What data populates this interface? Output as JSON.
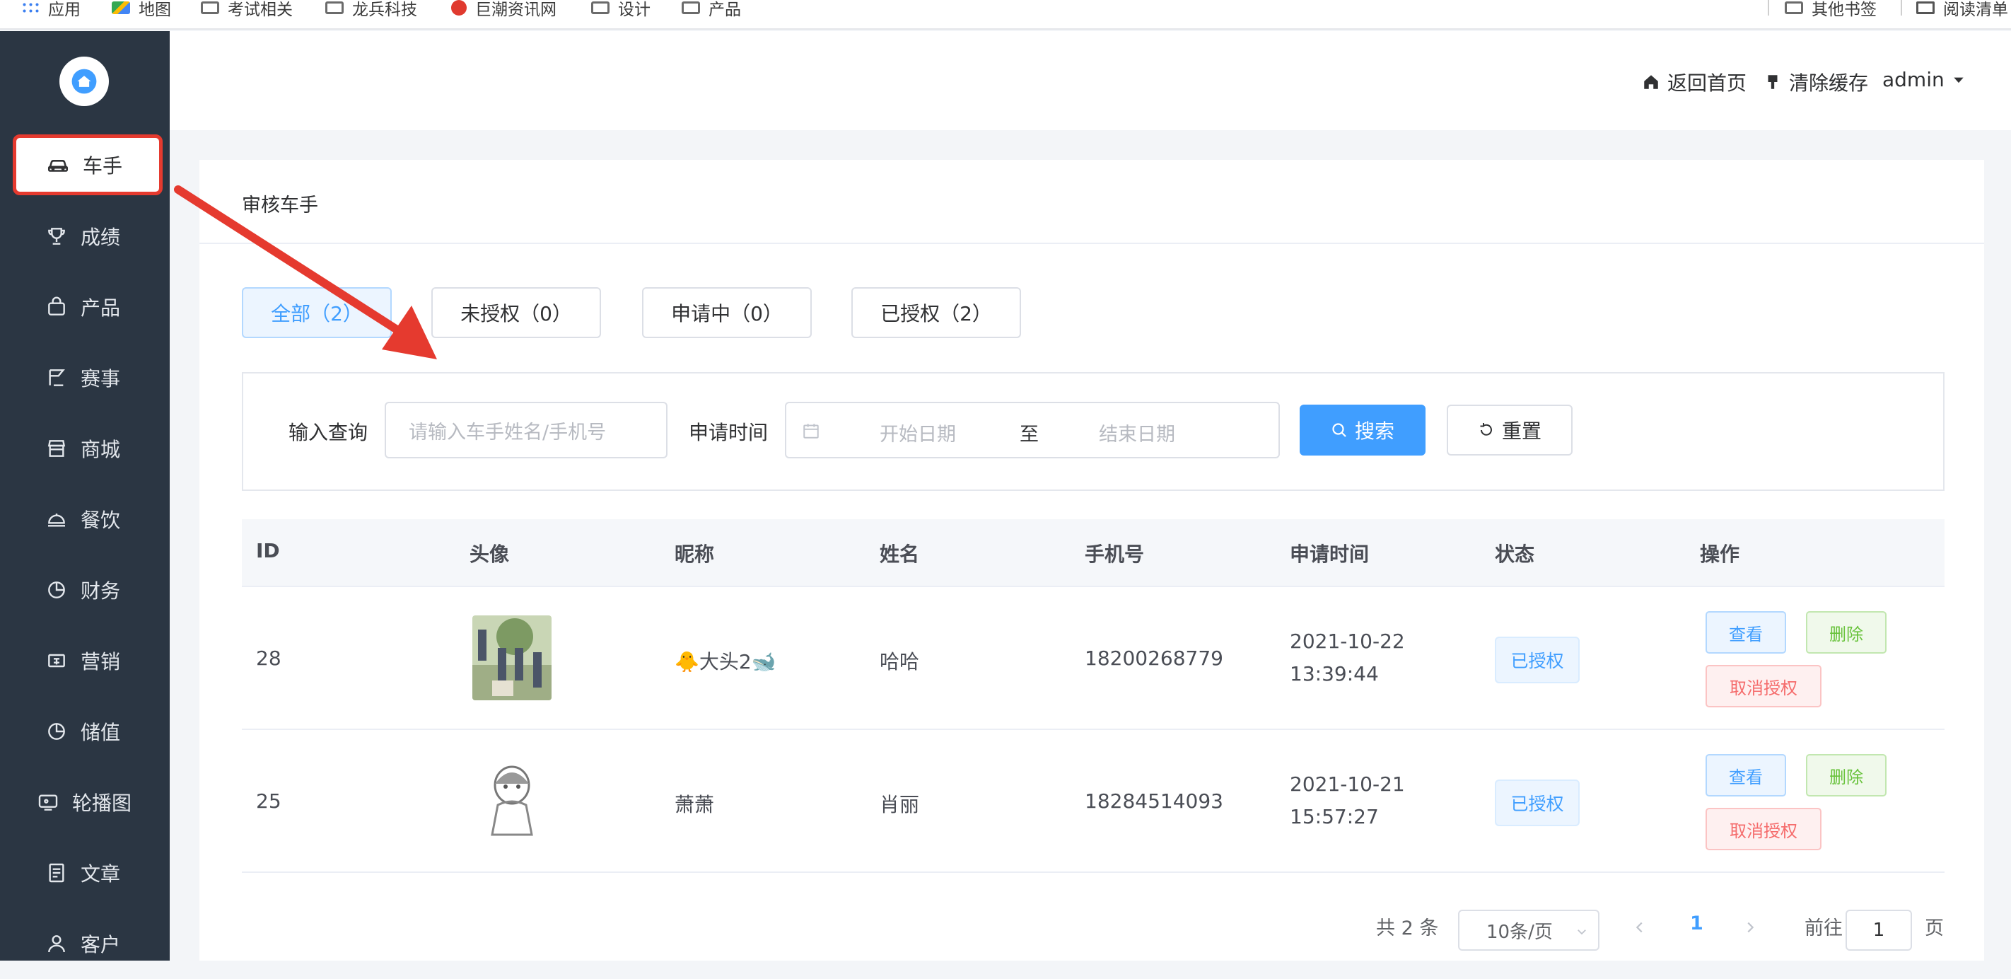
{
  "bookmarks": {
    "items": [
      "应用",
      "地图",
      "考试相关",
      "龙兵科技",
      "巨潮资讯网",
      "设计",
      "产品"
    ],
    "other": "其他书签",
    "reading": "阅读清单"
  },
  "sidebar": {
    "items": [
      {
        "label": "车手",
        "icon": "car-icon"
      },
      {
        "label": "成绩",
        "icon": "trophy-icon"
      },
      {
        "label": "产品",
        "icon": "bag-icon"
      },
      {
        "label": "赛事",
        "icon": "race-icon"
      },
      {
        "label": "商城",
        "icon": "shop-icon"
      },
      {
        "label": "餐饮",
        "icon": "dish-icon"
      },
      {
        "label": "财务",
        "icon": "pie-icon"
      },
      {
        "label": "营销",
        "icon": "ticket-icon"
      },
      {
        "label": "储值",
        "icon": "pie-icon"
      },
      {
        "label": "轮播图",
        "icon": "monitor-icon"
      },
      {
        "label": "文章",
        "icon": "document-icon"
      },
      {
        "label": "客户",
        "icon": "user-icon"
      }
    ]
  },
  "header": {
    "home": "返回首页",
    "clear_cache": "清除缓存",
    "user": "admin"
  },
  "page": {
    "title": "审核车手",
    "tabs": [
      "全部（2）",
      "未授权（0）",
      "申请中（0）",
      "已授权（2）"
    ]
  },
  "search": {
    "query_label": "输入查询",
    "query_placeholder": "请输入车手姓名/手机号",
    "time_label": "申请时间",
    "start_placeholder": "开始日期",
    "to": "至",
    "end_placeholder": "结束日期",
    "search_btn": "搜索",
    "reset_btn": "重置"
  },
  "table": {
    "headers": [
      "ID",
      "头像",
      "昵称",
      "姓名",
      "手机号",
      "申请时间",
      "状态",
      "操作"
    ],
    "rows": [
      {
        "id": "28",
        "nickname": "🐥大头2🐋",
        "name": "哈哈",
        "phone": "18200268779",
        "date": "2021-10-22",
        "time": "13:39:44",
        "status": "已授权"
      },
      {
        "id": "25",
        "nickname": "萧萧",
        "name": "肖丽",
        "phone": "18284514093",
        "date": "2021-10-21",
        "time": "15:57:27",
        "status": "已授权"
      }
    ],
    "actions": {
      "view": "查看",
      "delete": "删除",
      "cancel": "取消授权"
    }
  },
  "pagination": {
    "total": "共 2 条",
    "page_size": "10条/页",
    "current": "1",
    "goto": "前往",
    "goto_value": "1",
    "page_unit": "页"
  },
  "colors": {
    "sidebar_bg": "#2b3643",
    "primary": "#409eff",
    "success": "#67c23a",
    "danger": "#f56c6c",
    "annotation": "#e53a2f"
  }
}
